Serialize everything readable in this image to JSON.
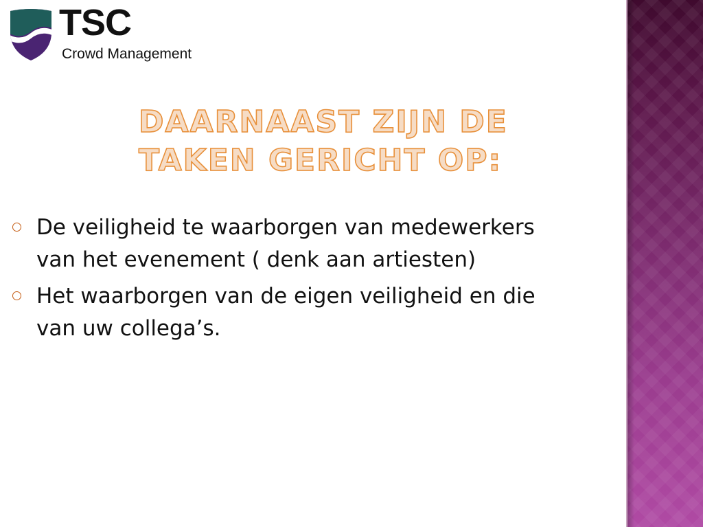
{
  "logo": {
    "name": "TSC",
    "tagline": "Crowd Management",
    "colors": {
      "shield_top": "#1f5d5a",
      "shield_bottom": "#4a2472",
      "wave": "#ffffff"
    }
  },
  "slide": {
    "title_lines": [
      "DAARNAAST ZIJN DE",
      "TAKEN GERICHT OP:"
    ],
    "bullets": [
      {
        "lines": [
          "De veiligheid te waarborgen van medewerkers",
          "van het evenement ( denk aan artiesten)"
        ]
      },
      {
        "lines": [
          "Het waarborgen van de eigen veiligheid en die",
          "van uw collega’s."
        ]
      }
    ],
    "bullet_icon": "circle-bullet-icon"
  },
  "theme": {
    "title_fill": "#f6dcc5",
    "title_outline": "#e8903a",
    "accent_band": "#7a2a6c",
    "bullet_color": "#c45a10",
    "text_color": "#111111"
  }
}
